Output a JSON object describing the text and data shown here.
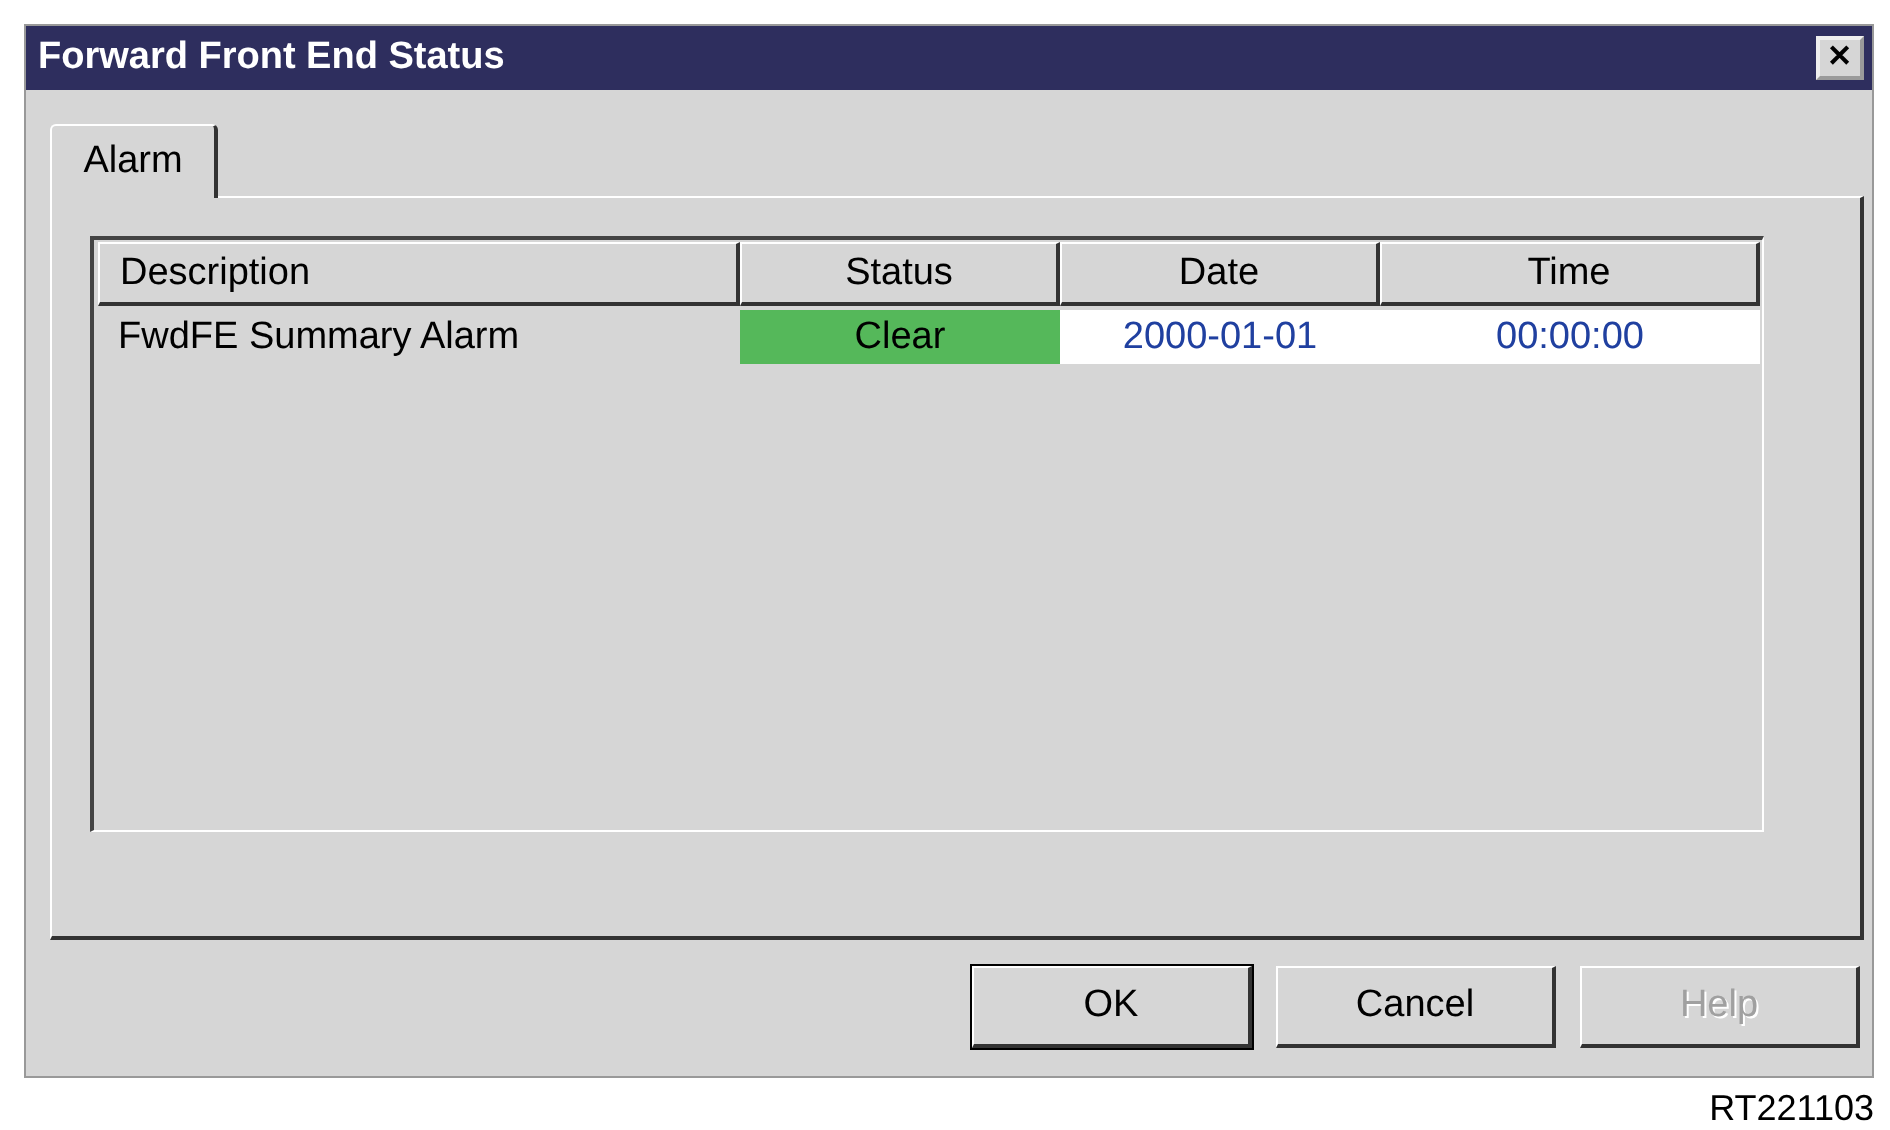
{
  "window": {
    "title": "Forward Front End Status",
    "close": "✕"
  },
  "tabs": [
    {
      "label": "Alarm",
      "selected": true
    }
  ],
  "table": {
    "columns": [
      "Description",
      "Status",
      "Date",
      "Time"
    ],
    "rows": [
      {
        "description": "FwdFE Summary Alarm",
        "status": "Clear",
        "color": "#55b85a",
        "date": "2000-01-01",
        "time": "00:00:00"
      }
    ]
  },
  "buttons": [
    {
      "label": "OK",
      "default": true,
      "disabled": false
    },
    {
      "label": "Cancel",
      "default": false,
      "disabled": false
    },
    {
      "label": "Help",
      "default": false,
      "disabled": true
    }
  ],
  "caption": "RT221103"
}
